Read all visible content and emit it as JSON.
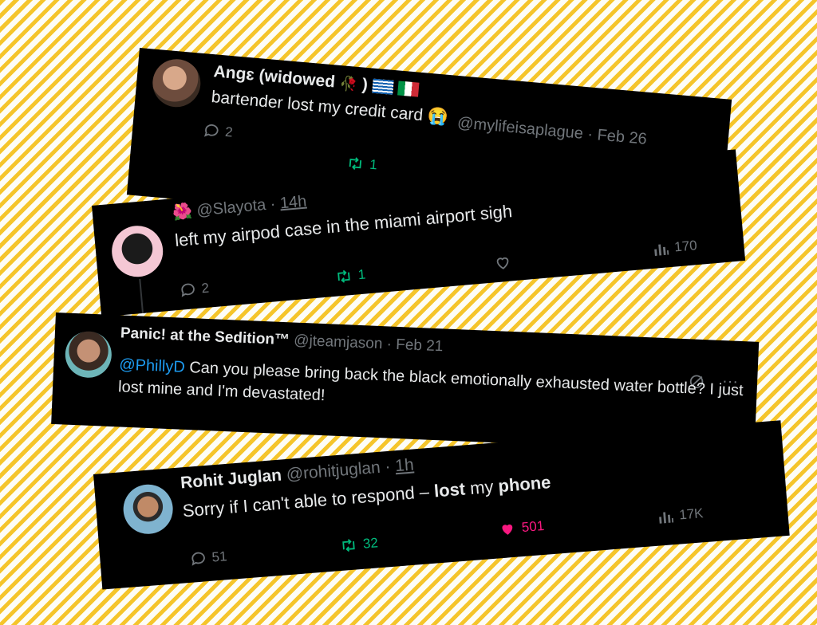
{
  "tweets": [
    {
      "display_name": "Angɛ (widowed",
      "name_suffix": ")",
      "handle": "@mylifeisaplague",
      "dot": "·",
      "time": "Feb 26",
      "text": "bartender lost my credit card",
      "emoji": "😭",
      "replies": "2",
      "retweets": "1"
    },
    {
      "emoji_prefix": "🌺",
      "handle": "@Slayota",
      "dot": "·",
      "time": "14h",
      "text": "left my airpod case in the miami airport sigh",
      "replies": "2",
      "retweets": "1",
      "views": "170"
    },
    {
      "display_name": "Panic! at the Sedition™",
      "handle": "@jteamjason",
      "dot": "·",
      "time": "Feb 21",
      "mention": "@PhillyD",
      "text": " Can you please bring back the black emotionally exhausted water bottle? I just lost mine and I'm devastated!",
      "more": "···"
    },
    {
      "display_name": "Rohit Juglan",
      "handle": "@rohitjuglan",
      "dot": "·",
      "time": "1h",
      "text_start": "Sorry if I can't able to respond – ",
      "text_bold1": "lost",
      "text_mid": " my ",
      "text_bold2": "phone",
      "replies": "51",
      "retweets": "32",
      "likes": "501",
      "views": "17K"
    }
  ],
  "colors": {
    "card_bg": "#000000",
    "retweet": "#00ba7c",
    "like": "#f91880",
    "mention": "#1d9bf0",
    "muted": "#71767b",
    "stripe": "#f5c52b"
  }
}
